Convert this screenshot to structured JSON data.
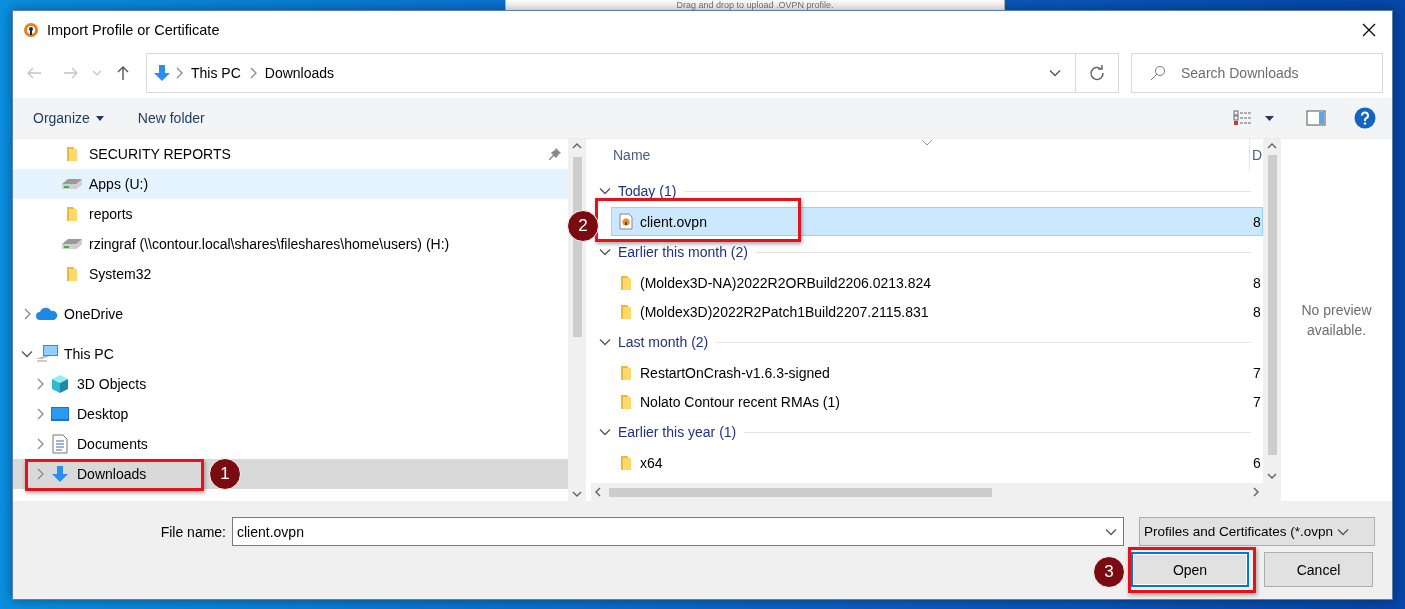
{
  "background_window": {
    "text": "Drag and drop to upload .OVPN profile."
  },
  "dialog": {
    "title": "Import Profile or Certificate"
  },
  "address_bar": {
    "crumbs": [
      "This PC",
      "Downloads"
    ],
    "search_placeholder": "Search Downloads"
  },
  "toolbar": {
    "organize": "Organize",
    "new_folder": "New folder"
  },
  "navigation": {
    "quick_access": [
      {
        "label": "SECURITY REPORTS",
        "kind": "folder",
        "pinned": true,
        "hovered": false
      },
      {
        "label": "Apps (U:)",
        "kind": "drive",
        "pinned": false,
        "hovered": true
      },
      {
        "label": "reports",
        "kind": "folder",
        "pinned": false,
        "hovered": false
      },
      {
        "label": "rzingraf (\\\\contour.local\\shares\\fileshares\\home\\users) (H:)",
        "kind": "drive",
        "pinned": false,
        "hovered": false
      },
      {
        "label": "System32",
        "kind": "folder",
        "pinned": false,
        "hovered": false
      }
    ],
    "tree": [
      {
        "label": "OneDrive",
        "kind": "cloud",
        "expanded": false,
        "selected": false
      },
      {
        "label": "This PC",
        "kind": "pc",
        "expanded": true,
        "selected": false,
        "children": [
          {
            "label": "3D Objects",
            "kind": "cube",
            "expanded": false,
            "selected": false
          },
          {
            "label": "Desktop",
            "kind": "desktop",
            "expanded": false,
            "selected": false
          },
          {
            "label": "Documents",
            "kind": "documents",
            "expanded": false,
            "selected": false
          },
          {
            "label": "Downloads",
            "kind": "downloads",
            "expanded": false,
            "selected": true
          }
        ]
      }
    ]
  },
  "file_list": {
    "columns": [
      "Name",
      "D"
    ],
    "groups": [
      {
        "label": "Today (1)",
        "expanded": true,
        "files": [
          {
            "name": "client.ovpn",
            "kind": "ovpn",
            "column_2": "8",
            "selected": true
          }
        ]
      },
      {
        "label": "Earlier this month (2)",
        "expanded": true,
        "files": [
          {
            "name": "(Moldex3D-NA)2022R2ORBuild2206.0213.824",
            "kind": "folder",
            "column_2": "8",
            "selected": false
          },
          {
            "name": "(Moldex3D)2022R2Patch1Build2207.2115.831",
            "kind": "folder",
            "column_2": "8",
            "selected": false
          }
        ]
      },
      {
        "label": "Last month (2)",
        "expanded": true,
        "files": [
          {
            "name": "RestartOnCrash-v1.6.3-signed",
            "kind": "folder",
            "column_2": "7",
            "selected": false
          },
          {
            "name": "Nolato Contour recent RMAs (1)",
            "kind": "folder",
            "column_2": "7",
            "selected": false
          }
        ]
      },
      {
        "label": "Earlier this year (1)",
        "expanded": true,
        "files": [
          {
            "name": "x64",
            "kind": "folder",
            "column_2": "6",
            "selected": false
          }
        ]
      }
    ]
  },
  "preview": {
    "message": "No preview available."
  },
  "footer": {
    "file_name_label": "File name:",
    "file_name": "client.ovpn",
    "filter": "Profiles and Certificates (*.ovpn",
    "buttons": [
      {
        "label": "Open",
        "default": true
      },
      {
        "label": "Cancel",
        "default": false
      }
    ]
  },
  "annotations": [
    {
      "number": "1"
    },
    {
      "number": "2"
    },
    {
      "number": "3"
    }
  ]
}
